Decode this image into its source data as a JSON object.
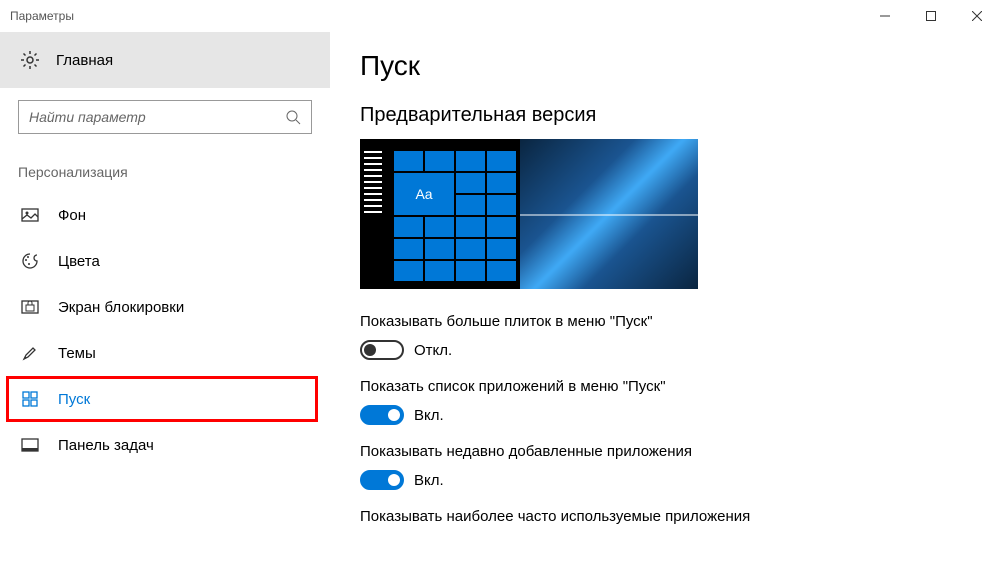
{
  "window": {
    "title": "Параметры"
  },
  "sidebar": {
    "home": {
      "label": "Главная"
    },
    "search": {
      "placeholder": "Найти параметр"
    },
    "section": "Персонализация",
    "items": [
      {
        "label": "Фон",
        "icon": "picture-icon",
        "active": false
      },
      {
        "label": "Цвета",
        "icon": "palette-icon",
        "active": false
      },
      {
        "label": "Экран блокировки",
        "icon": "lockscreen-icon",
        "active": false
      },
      {
        "label": "Темы",
        "icon": "brush-icon",
        "active": false
      },
      {
        "label": "Пуск",
        "icon": "start-icon",
        "active": true
      },
      {
        "label": "Панель задач",
        "icon": "taskbar-icon",
        "active": false
      }
    ]
  },
  "main": {
    "title": "Пуск",
    "preview_label": "Предварительная версия",
    "tile_text": "Aa",
    "settings": [
      {
        "label": "Показывать больше плиток в меню \"Пуск\"",
        "state": "off",
        "state_label": "Откл."
      },
      {
        "label": "Показать список приложений в меню \"Пуск\"",
        "state": "on",
        "state_label": "Вкл."
      },
      {
        "label": "Показывать недавно добавленные приложения",
        "state": "on",
        "state_label": "Вкл."
      },
      {
        "label": "Показывать наиболее часто используемые приложения",
        "state": "",
        "state_label": ""
      }
    ]
  },
  "colors": {
    "accent": "#0078D7",
    "highlight_border": "#FF0000"
  }
}
